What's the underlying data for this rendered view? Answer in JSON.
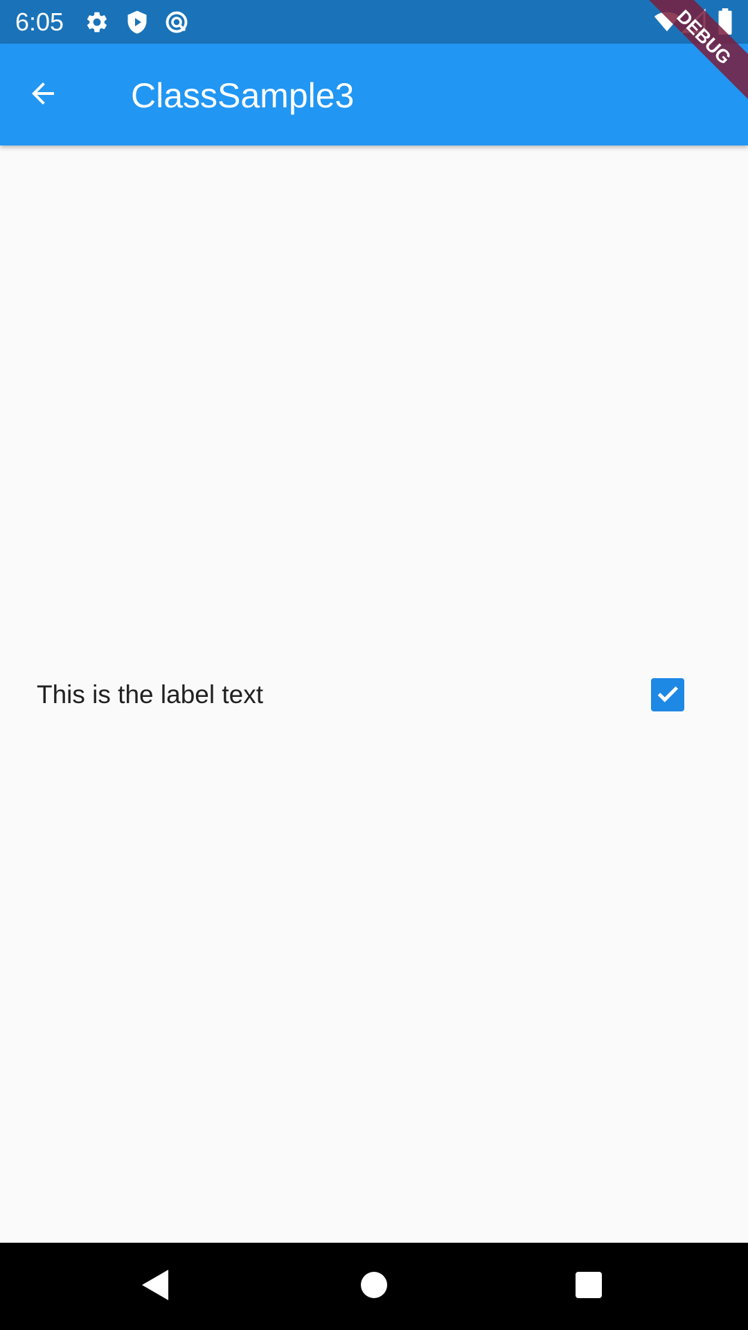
{
  "status_bar": {
    "time": "6:05",
    "left_icons": [
      "gear-icon",
      "shield-play-icon",
      "circle-no-entry-icon"
    ],
    "right_icons": [
      "wifi-icon",
      "cell-signal-icon",
      "battery-icon"
    ],
    "background": "#1a73b8"
  },
  "debug_banner": {
    "label": "DEBUG",
    "color": "#7a1f3d"
  },
  "app_bar": {
    "title": "ClassSample3",
    "back_icon": "arrow-back-icon",
    "background": "#2196f3"
  },
  "content": {
    "checkbox_row": {
      "label": "This is the label text",
      "checked": true,
      "checkbox_color": "#1e88e5"
    }
  },
  "nav_bar": {
    "buttons": [
      "back-triangle-icon",
      "home-circle-icon",
      "recents-square-icon"
    ]
  }
}
